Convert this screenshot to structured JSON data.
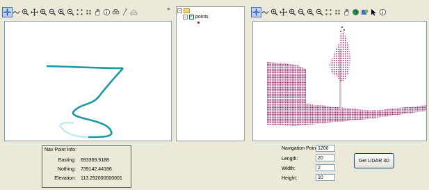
{
  "colors": {
    "path_teal": "#1a9aa3",
    "path_light": "#c9e9ee",
    "points_magenta": "#8a0f5a",
    "selection_blue": "#316ac5"
  },
  "left_toolbar": {
    "icons": [
      "pan-select-icon",
      "measure-icon",
      "zoom-in-icon",
      "pan-icon",
      "zoom-in-fixed-icon",
      "zoom-out-fixed-icon",
      "zoom-to-layer-icon",
      "zoom-out-icon",
      "full-extent-icon",
      "zoom-extent-icon",
      "hand-icon",
      "identify-icon",
      "find-icon",
      "go-to-xy-icon",
      "layer-icon"
    ]
  },
  "right_toolbar": {
    "icons": [
      "pan-select-icon",
      "measure-icon",
      "zoom-in-icon",
      "pan-icon",
      "zoom-in-fixed-icon",
      "zoom-out-fixed-icon",
      "zoom-to-layer-icon",
      "zoom-out-icon",
      "full-extent-icon",
      "zoom-extent-icon",
      "hand-icon",
      "globe-icon",
      "navigate-icon",
      "pointer-icon",
      "identify-icon"
    ]
  },
  "overflow_chevron": "»",
  "toc": {
    "layer_label": "points"
  },
  "nav_point_info": {
    "title": "Nav Point Info:",
    "easting_label": "Easting:",
    "easting_value": "693369.9188",
    "northing_label": "Nothing:",
    "northing_value": "739142.44186",
    "elevation_label": "Elevation:",
    "elevation_value": "113.292000000001"
  },
  "lidar_form": {
    "navigation_point_label": "Navigation Point:",
    "navigation_point_value": "1200",
    "length_label": "Length:",
    "length_value": "20",
    "width_label": "Width:",
    "width_value": "2",
    "height_label": "Height:",
    "height_value": "10",
    "button_label": "Get LiDAR 3D"
  }
}
